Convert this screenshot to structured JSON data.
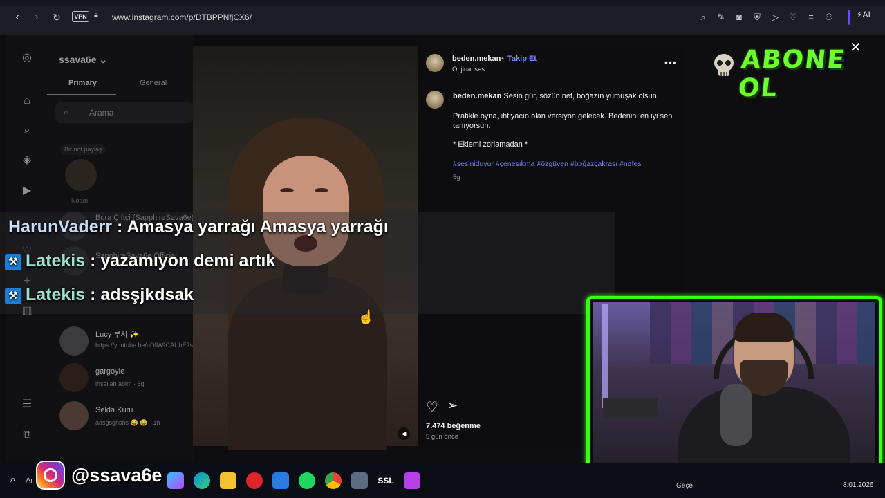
{
  "browser": {
    "vpn_label": "VPN",
    "url": "www.instagram.com/p/DTBPPNfjCX6/",
    "ai_label": "AI"
  },
  "dm_panel": {
    "username": "ssava6e",
    "chevron": "⌄",
    "tabs": [
      {
        "label": "Primary"
      },
      {
        "label": "General"
      }
    ],
    "search_placeholder": "Arama",
    "note": {
      "bubble": "Bir not paylaş",
      "label": "Notun"
    },
    "conversations": [
      {
        "name": "Bora Çiftçi (SapphireSava6e)",
        "sub": ""
      },
      {
        "name": "SapphireSava6e Official",
        "sub": ""
      },
      {
        "name": "Lucy 루시 ✨",
        "sub": "https://youtube.be/uDIfA9CAUhE?si="
      },
      {
        "name": "gargoyle",
        "sub": "inşallah abim · 6g"
      },
      {
        "name": "Selda Kuru",
        "sub": "adsgsghshs 😂 😂 · 1h"
      }
    ]
  },
  "post": {
    "author": "beden.mekan",
    "dot": "•",
    "follow_label": "Takip Et",
    "audio": "Orijinal ses",
    "more": "•••",
    "caption_author": "beden.mekan",
    "caption_line1": "Sesin gür, sözün net, boğazın yumuşak olsun.",
    "caption_line2": "Pratikle oyna, ihtiyacın olan versiyon gelecek. Bedenini en iyi sen tanıyorsun.",
    "caption_line3": "* Eklemi zorlamadan *",
    "hashtags": "#sesiniduyur #çenesıkma #özgüven #boğazçakrası #nefes",
    "caption_age": "5g",
    "likes": "7.474 beğenme",
    "date": "5 gün önce",
    "close": "✕"
  },
  "chat": [
    {
      "user": "HarunVaderr",
      "message": ": Amasya yarrağı Amasya yarrağı",
      "badge": false
    },
    {
      "user": "Latekis",
      "message": ": yazamıyon demi artık",
      "badge": true
    },
    {
      "user": "Latekis",
      "message": ": adsşjkdsak",
      "badge": true
    }
  ],
  "overlay": {
    "subscribe": "ABONE OL",
    "instagram_handle": "@ssava6e"
  },
  "taskbar": {
    "search_text": "Ar",
    "weather": "Geçe",
    "date": "8.01.2026",
    "apps": [
      {
        "icon": "copilot-icon",
        "label": ""
      },
      {
        "icon": "edge-icon",
        "label": ""
      },
      {
        "icon": "folder-icon",
        "label": ""
      },
      {
        "icon": "opera-icon",
        "label": ""
      },
      {
        "icon": "mail-icon",
        "label": ""
      },
      {
        "icon": "spotify-icon",
        "label": ""
      },
      {
        "icon": "chrome-icon",
        "label": ""
      },
      {
        "icon": "settings-icon",
        "label": ""
      },
      {
        "icon": "ssl-icon",
        "label": "SSL"
      },
      {
        "icon": "instagram-app-icon",
        "label": ""
      }
    ]
  },
  "colors": {
    "browser_bar": "#1c1d26",
    "follow_link": "#7a8cff",
    "hashtag": "#6b84e8",
    "subscribe_green": "#6bff2b",
    "webcam_border": "#39ff14"
  }
}
